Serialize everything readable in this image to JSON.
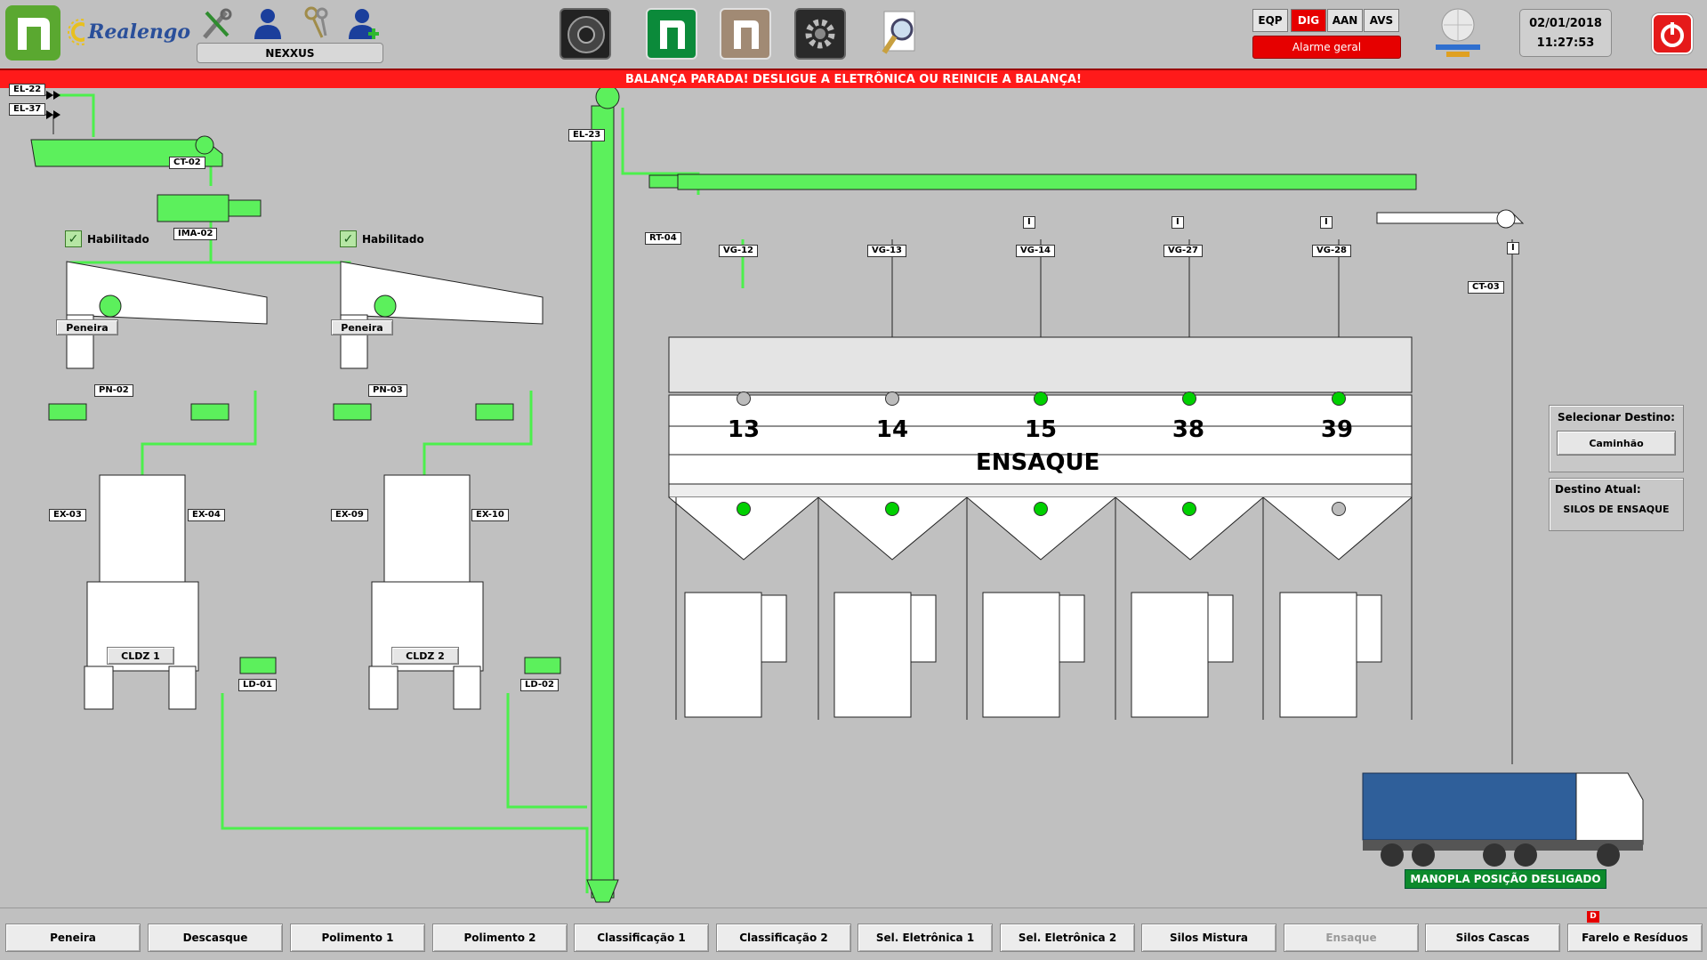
{
  "header": {
    "brand": "Realengo",
    "user": "NEXXUS",
    "modes": [
      {
        "label": "EQP",
        "active": false
      },
      {
        "label": "DIG",
        "active": true
      },
      {
        "label": "AAN",
        "active": false
      },
      {
        "label": "AVS",
        "active": false
      }
    ],
    "alarm": "Alarme geral",
    "date": "02/01/2018",
    "time": "11:27:53",
    "toolbar_icons": [
      "tools-icon",
      "user-icon",
      "keys-icon",
      "add-user-icon",
      "speaker-icon",
      "nexxus-green-icon",
      "nexxus-brown-icon",
      "settings-gear-icon",
      "search-report-icon",
      "network-icon",
      "power-icon"
    ]
  },
  "banner": "BALANÇA PARADA! DESLIGUE A ELETRÔNICA OU REINICIE A BALANÇA!",
  "equipment": {
    "el22": "EL-22",
    "el37": "EL-37",
    "ct02": "CT-02",
    "ima02": "IMA-02",
    "habilitado_1": "Habilitado",
    "habilitado_2": "Habilitado",
    "peneira_1": "Peneira",
    "peneira_2": "Peneira",
    "pn02": "PN-02",
    "pn03": "PN-03",
    "ex03": "EX-03",
    "ex04": "EX-04",
    "ex09": "EX-09",
    "ex10": "EX-10",
    "cldz1": "CLDZ 1",
    "cldz2": "CLDZ 2",
    "ld01": "LD-01",
    "ld02": "LD-02",
    "el23": "EL-23",
    "rt04": "RT-04",
    "ct03": "CT-03",
    "valves": [
      "VG-12",
      "VG-13",
      "VG-14",
      "VG-27",
      "VG-28"
    ],
    "silos": [
      {
        "number": "13",
        "top_active": false,
        "bottom_active": true
      },
      {
        "number": "14",
        "top_active": false,
        "bottom_active": true
      },
      {
        "number": "15",
        "top_active": true,
        "bottom_active": true
      },
      {
        "number": "38",
        "top_active": true,
        "bottom_active": true
      },
      {
        "number": "39",
        "top_active": true,
        "bottom_active": false
      }
    ],
    "ensaque": "ENSAQUE",
    "indicator_i": "I"
  },
  "destination": {
    "select_label": "Selecionar Destino:",
    "select_button": "Caminhão",
    "current_label": "Destino Atual:",
    "current_value": "SILOS DE ENSAQUE"
  },
  "truck_status": "MANOPLA POSIÇÃO DESLIGADO",
  "nav": [
    {
      "label": "Peneira",
      "disabled": false
    },
    {
      "label": "Descasque",
      "disabled": false
    },
    {
      "label": "Polimento 1",
      "disabled": false
    },
    {
      "label": "Polimento 2",
      "disabled": false
    },
    {
      "label": "Classificação 1",
      "disabled": false
    },
    {
      "label": "Classificação 2",
      "disabled": false
    },
    {
      "label": "Sel. Eletrônica 1",
      "disabled": false
    },
    {
      "label": "Sel. Eletrônica 2",
      "disabled": false
    },
    {
      "label": "Silos Mistura",
      "disabled": false
    },
    {
      "label": "Ensaque",
      "disabled": true
    },
    {
      "label": "Silos Cascas",
      "disabled": false
    },
    {
      "label": "Farelo e Resíduos",
      "disabled": false
    }
  ],
  "nav_badge": "D",
  "colors": {
    "active_green": "#5cf05c",
    "alarm_red": "#ff1a1a",
    "led_green": "#00d000",
    "led_off": "#bcbcbc"
  }
}
